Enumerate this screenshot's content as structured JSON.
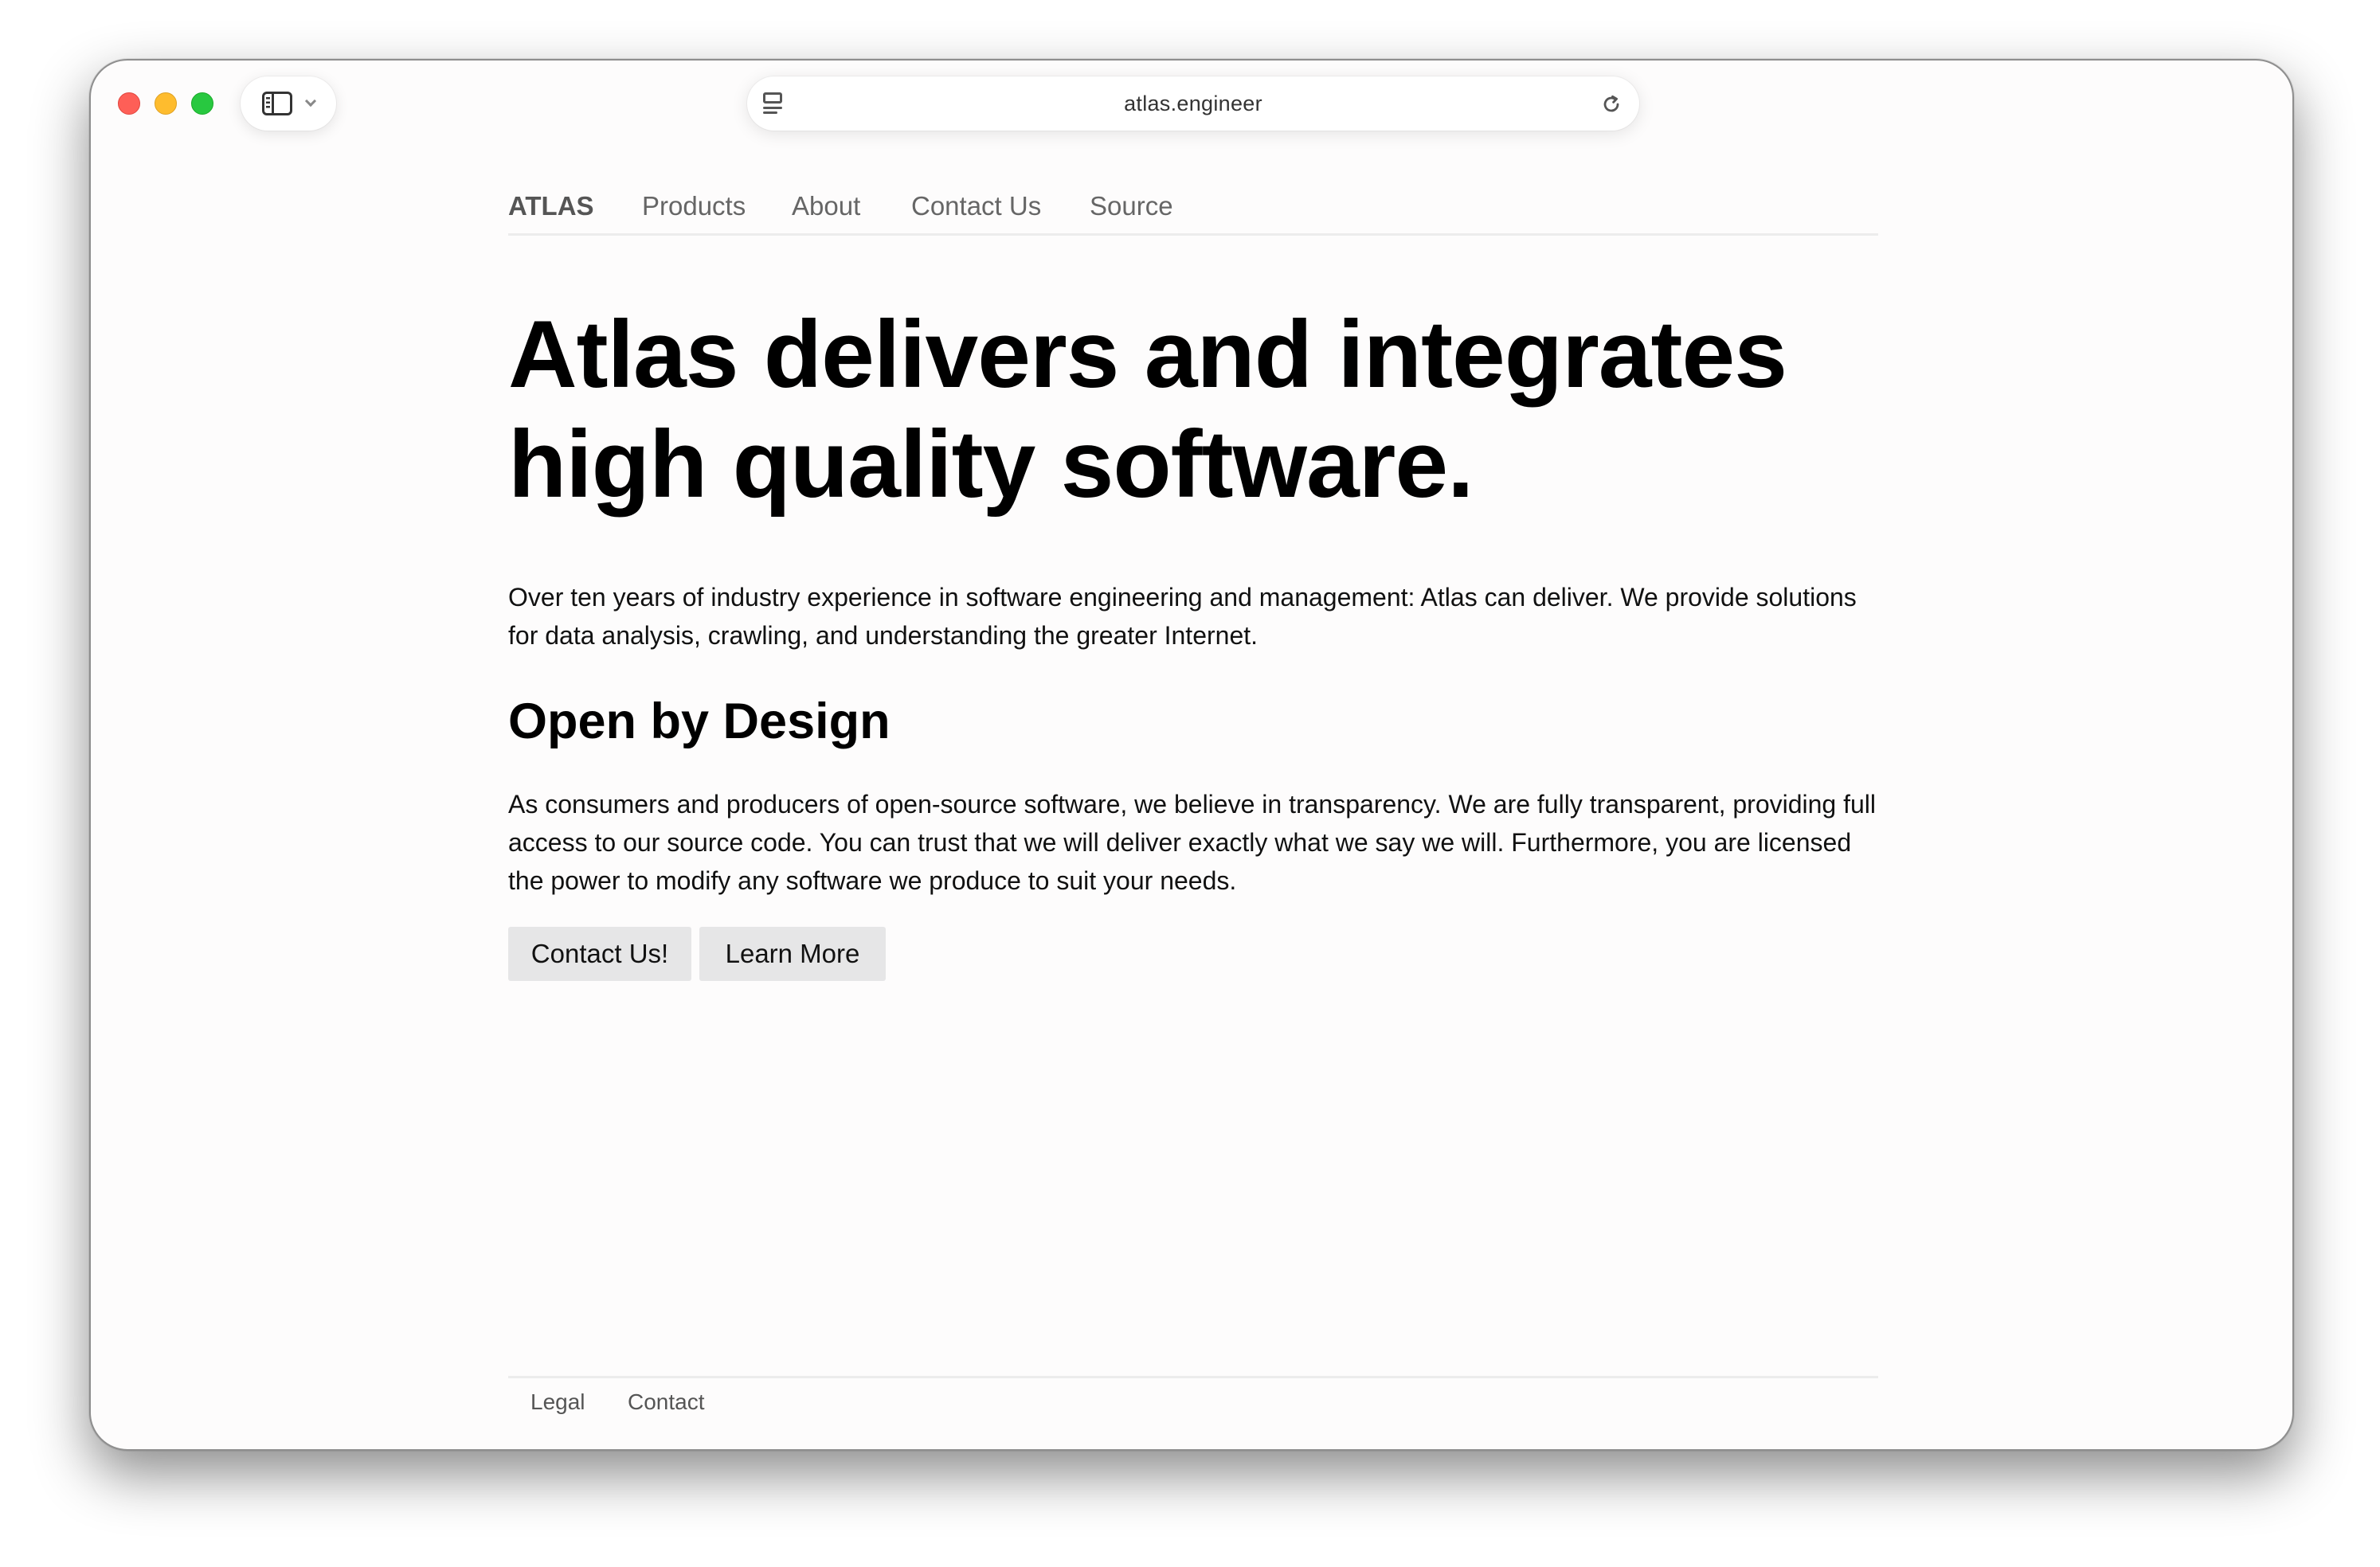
{
  "browser": {
    "url": "atlas.engineer"
  },
  "nav": {
    "brand": "ATLAS",
    "items": [
      "Products",
      "About",
      "Contact Us",
      "Source"
    ]
  },
  "main": {
    "headline_line1": "Atlas delivers and integrates",
    "headline_line2": "high quality software.",
    "intro": "Over ten years of industry experience in software engineering and management: Atlas can deliver. We provide solutions for data analysis, crawling, and understanding the greater Internet.",
    "section_title": "Open by Design",
    "section_body": "As consumers and producers of open-source software, we believe in transparency. We are fully transparent, providing full access to our source code. You can trust that we will deliver exactly what we say we will. Furthermore, you are licensed the power to modify any software we produce to suit your needs.",
    "buttons": {
      "contact": "Contact Us!",
      "learn_more": "Learn More"
    }
  },
  "footer": {
    "items": [
      "Legal",
      "Contact"
    ]
  },
  "colors": {
    "close": "#fe5f57",
    "minimize": "#febc2e",
    "maximize": "#28c840",
    "button_bg": "#e6e6e7",
    "nav_text": "#666666"
  },
  "icons": {
    "sidebar": "sidebar-icon",
    "reader": "reader-mode-icon",
    "reload": "reload-icon"
  }
}
